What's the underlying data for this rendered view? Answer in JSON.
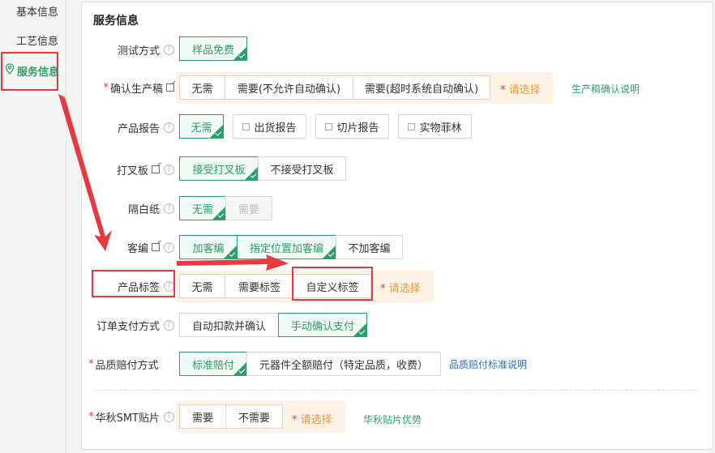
{
  "sidebar": {
    "items": [
      {
        "label": "基本信息"
      },
      {
        "label": "工艺信息"
      },
      {
        "label": "服务信息"
      }
    ]
  },
  "panel": {
    "title": "服务信息",
    "rows": {
      "test_method": {
        "label": "测试方式",
        "options": [
          "样品免费"
        ]
      },
      "confirm_draft": {
        "label": "确认生产稿",
        "options": [
          "无需",
          "需要(不允许自动确认)",
          "需要(超时系统自动确认)"
        ],
        "hint": "请选择",
        "link": "生产稿确认说明"
      },
      "product_report": {
        "label": "产品报告",
        "options": [
          "无需",
          "出货报告",
          "切片报告",
          "实物菲林"
        ]
      },
      "cross_board": {
        "label": "打叉板",
        "options": [
          "接受打叉板",
          "不接受打叉板"
        ]
      },
      "paper": {
        "label": "隔白纸",
        "options": [
          "无需",
          "需要"
        ]
      },
      "customer_code": {
        "label": "客编",
        "options": [
          "加客编",
          "指定位置加客编",
          "不加客编"
        ]
      },
      "product_label": {
        "label": "产品标签",
        "options": [
          "无需",
          "需要标签",
          "自定义标签"
        ],
        "hint": "请选择"
      },
      "payment": {
        "label": "订单支付方式",
        "options": [
          "自动扣款并确认",
          "手动确认支付"
        ]
      },
      "quality": {
        "label": "品质赔付方式",
        "options": [
          "标准赔付",
          "元器件全额赔付（特定品质，收费）"
        ],
        "link": "品质赔付标准说明"
      },
      "smt": {
        "label": "华秋SMT贴片",
        "options": [
          "需要",
          "不需要"
        ],
        "hint": "请选择",
        "link": "华秋贴片优势"
      }
    }
  },
  "colors": {
    "accent": "#2c9d6c",
    "annotation": "#e8393f",
    "hint_bg": "#fdf2e3",
    "link_blue": "#2b6fb6"
  }
}
